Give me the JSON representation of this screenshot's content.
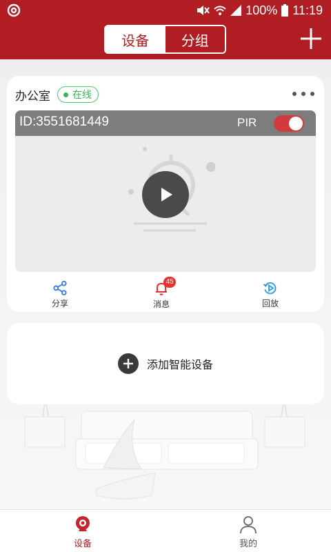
{
  "status_bar": {
    "battery": "100%",
    "time": "11:19",
    "icons": [
      "app-logo-icon",
      "mute-vibrate-icon",
      "wifi-icon",
      "signal-icon",
      "battery-icon"
    ]
  },
  "header": {
    "tabs": [
      {
        "label": "设备",
        "active": true
      },
      {
        "label": "分组",
        "active": false
      }
    ],
    "add_icon": "plus-icon"
  },
  "device_card": {
    "name": "办公室",
    "status": "在线",
    "device_id": "ID:3551681449",
    "pir_label": "PIR",
    "pir_enabled": true,
    "actions": [
      {
        "label": "分享",
        "icon": "share-icon"
      },
      {
        "label": "消息",
        "icon": "bell-icon",
        "badge": "45"
      },
      {
        "label": "回放",
        "icon": "playback-icon"
      }
    ]
  },
  "add_device": {
    "label": "添加智能设备"
  },
  "bottom_nav": {
    "items": [
      {
        "label": "设备",
        "active": true,
        "icon": "camera-icon"
      },
      {
        "label": "我的",
        "active": false,
        "icon": "user-icon"
      }
    ]
  },
  "colors": {
    "brand": "#b01e23",
    "online": "#37b458",
    "badge": "#e8302c",
    "toggle_on": "#d23a3f"
  }
}
